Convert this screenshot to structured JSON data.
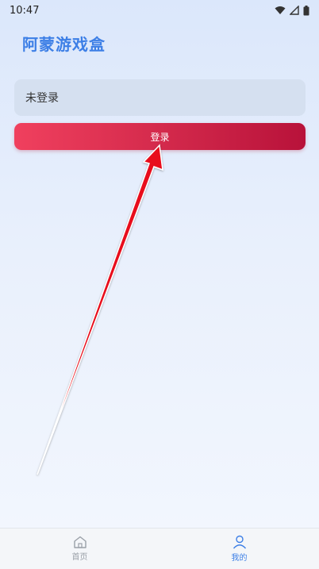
{
  "status_bar": {
    "time": "10:47",
    "icons": [
      "wifi-icon",
      "signal-icon",
      "battery-icon"
    ]
  },
  "app": {
    "title": "阿蒙游戏盒",
    "title_color": "#3d7fe6"
  },
  "account": {
    "status_text": "未登录",
    "login_label": "登录",
    "button_colors": [
      "#f0405e",
      "#b8123a"
    ]
  },
  "tab_bar": {
    "items": [
      {
        "label": "首页",
        "icon": "home-icon",
        "active": false
      },
      {
        "label": "我的",
        "icon": "user-icon",
        "active": true
      }
    ],
    "active_color": "#3d7fe6",
    "inactive_color": "#9aa0a8"
  }
}
